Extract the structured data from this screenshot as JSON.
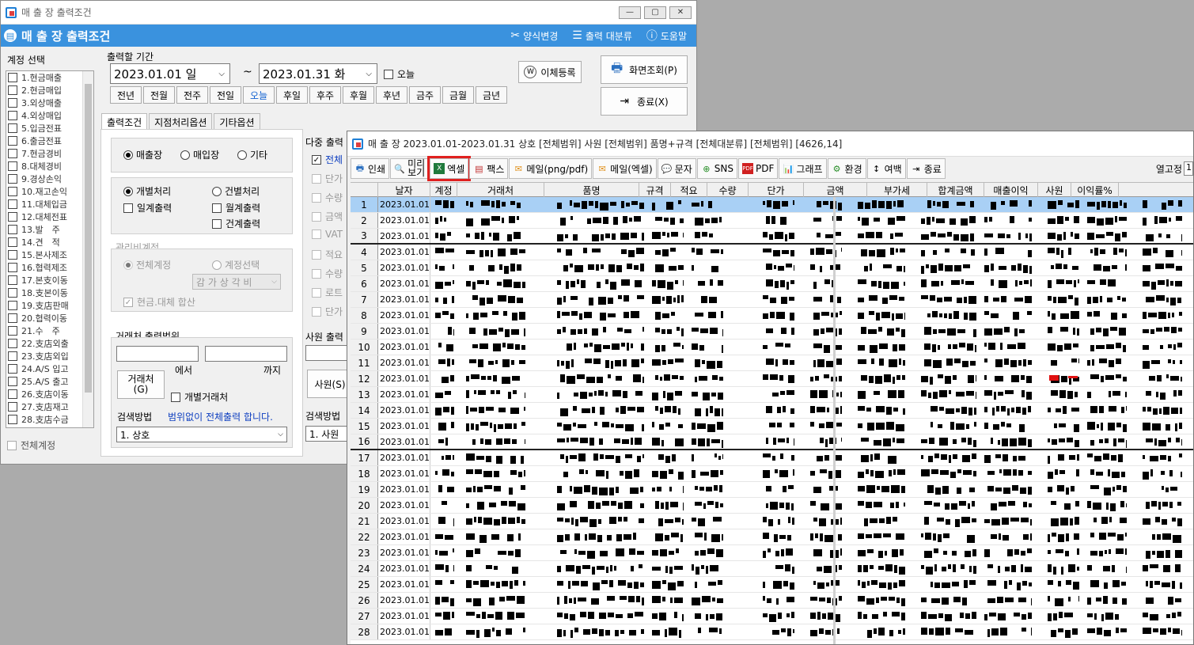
{
  "main_window": {
    "title": "매 출 장 출력조건",
    "header": "매 출 장 출력조건",
    "header_buttons": [
      "양식변경",
      "출력 대분류",
      "도움말"
    ],
    "account_label": "계정 선택",
    "accounts": [
      "1.현금매출",
      "2.현금매입",
      "3.외상매출",
      "4.외상매입",
      "5.입금전표",
      "6.출금전표",
      "7.현금경비",
      "8.대체경비",
      "9.경상손익",
      "10.재고손익",
      "11.대체입금",
      "12.대체전표",
      "13.발　주",
      "14.견　적",
      "15.본사제조",
      "16.협력제조",
      "17.본支이동",
      "18.支본이동",
      "19.支店판매",
      "20.협력이동",
      "21.수　주",
      "22.支店외출",
      "23.支店외입",
      "24.A/S 입고",
      "25.A/S 출고",
      "26.支店이동",
      "27.支店재고",
      "28.支店수금"
    ],
    "all_accounts": "전체계정",
    "period_label": "출력할 기간",
    "start_date": "2023.01.01 일",
    "tilde": "~",
    "end_date": "2023.01.31 화",
    "today_check": "오늘",
    "period_buttons": [
      "전년",
      "전월",
      "전주",
      "전일",
      "오늘",
      "후일",
      "후주",
      "후월",
      "후년",
      "금주",
      "금월",
      "금년"
    ],
    "transfer_button": "이체등록",
    "view_button": "화면조회(P)",
    "close_button": "종료(X)",
    "tabs": [
      "출력조건",
      "지점처리옵션",
      "기타옵션"
    ],
    "type_options": [
      "매출장",
      "매입장",
      "기타"
    ],
    "proc_options": [
      "개별처리",
      "건별처리"
    ],
    "check_options": [
      "일계출력",
      "월계출력",
      "건계출력"
    ],
    "mgmt_label": "관리비계정",
    "mgmt_options": [
      "전체계정",
      "계정선택"
    ],
    "mgmt_combo": "감 가 상 각 비",
    "cash_transfer": "현금.대체 합산",
    "client_range_label": "거래처 출력범위",
    "from_label": "에서",
    "to_label": "까지",
    "client_button": "거래처\n(G)",
    "individual_client": "개별거래처",
    "search_method_label": "검색방법",
    "search_note": "범위없이 전체출력 합니다.",
    "search_combo": "1. 상호",
    "multi_output_label": "다중 출력",
    "multi_items": [
      "전체",
      "단가",
      "수량",
      "금액",
      "VAT",
      "적요",
      "수량",
      "로트",
      "단가"
    ],
    "employee_range_label": "사원 출력",
    "employee_button": "사원(S)",
    "search_method2": "검색방법",
    "search_combo2": "1. 사원"
  },
  "report_window": {
    "title": "매 출 장  2023.01.01-2023.01.31    상호 [전체범위] 사원 [전체범위] 품명+규격 [전체대분류] [전체범위] [4626,14]",
    "toolbar": [
      "인쇄",
      "미리\n보기",
      "엑셀",
      "팩스",
      "메일(png/pdf)",
      "메일(엑셀)",
      "문자",
      "SNS",
      "PDF",
      "그래프",
      "환경",
      "여백",
      "종료"
    ],
    "right_label": "열고정",
    "right_value": "1",
    "columns": [
      "날자",
      "계정",
      "거래처",
      "품명",
      "규격",
      "적요",
      "수량",
      "단가",
      "금액",
      "부가세",
      "합계금액",
      "매출이익",
      "사원",
      "이익률%"
    ],
    "rows": [
      {
        "n": "1",
        "date": "2023.01.01"
      },
      {
        "n": "2",
        "date": "2023.01.01"
      },
      {
        "n": "3",
        "date": "2023.01.01"
      },
      {
        "n": "4",
        "date": "2023.01.01"
      },
      {
        "n": "5",
        "date": "2023.01.01"
      },
      {
        "n": "6",
        "date": "2023.01.01"
      },
      {
        "n": "7",
        "date": "2023.01.01"
      },
      {
        "n": "8",
        "date": "2023.01.01"
      },
      {
        "n": "9",
        "date": "2023.01.01"
      },
      {
        "n": "10",
        "date": "2023.01.01"
      },
      {
        "n": "11",
        "date": "2023.01.01"
      },
      {
        "n": "12",
        "date": "2023.01.01"
      },
      {
        "n": "13",
        "date": "2023.01.01"
      },
      {
        "n": "14",
        "date": "2023.01.01"
      },
      {
        "n": "15",
        "date": "2023.01.01"
      },
      {
        "n": "16",
        "date": "2023.01.01"
      },
      {
        "n": "17",
        "date": "2023.01.01"
      },
      {
        "n": "18",
        "date": "2023.01.01"
      },
      {
        "n": "19",
        "date": "2023.01.01"
      },
      {
        "n": "20",
        "date": "2023.01.01"
      },
      {
        "n": "21",
        "date": "2023.01.01"
      },
      {
        "n": "22",
        "date": "2023.01.01"
      },
      {
        "n": "23",
        "date": "2023.01.01"
      },
      {
        "n": "24",
        "date": "2023.01.01"
      },
      {
        "n": "25",
        "date": "2023.01.01"
      },
      {
        "n": "26",
        "date": "2023.01.01"
      },
      {
        "n": "27",
        "date": "2023.01.01"
      },
      {
        "n": "28",
        "date": "2023.01.01"
      }
    ]
  }
}
